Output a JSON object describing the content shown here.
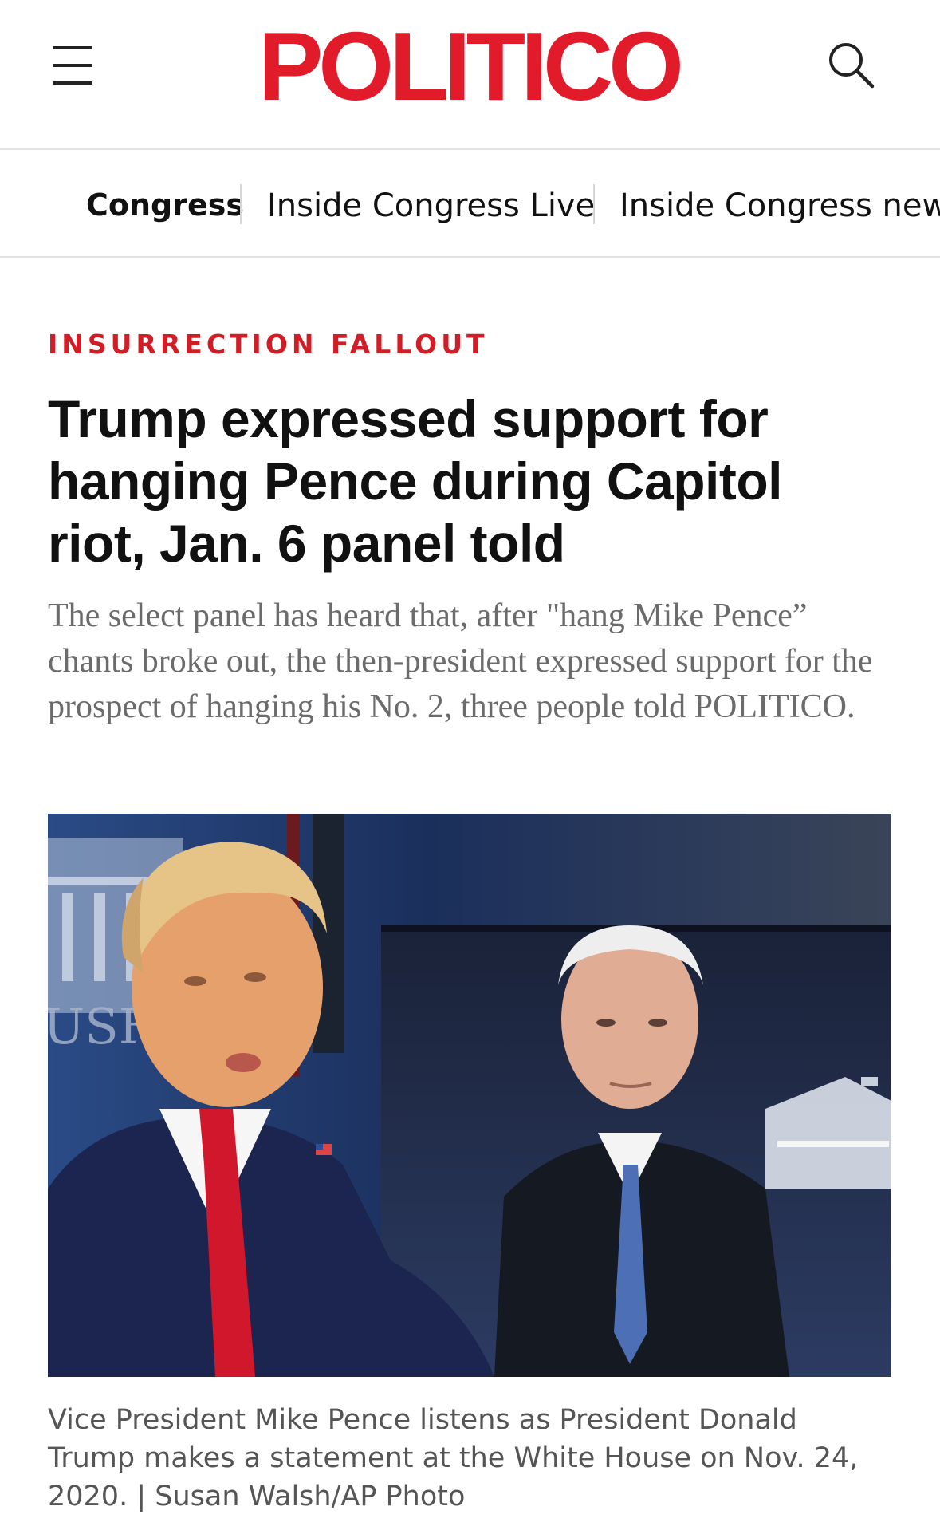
{
  "header": {
    "logo": "POLITICO",
    "menu_icon": "hamburger-menu-icon",
    "search_icon": "search-icon",
    "brand_color": "#e21b2b"
  },
  "subnav": {
    "section": "Congress",
    "items": [
      "Inside Congress Live",
      "Inside Congress newsl"
    ]
  },
  "article": {
    "kicker": "INSURRECTION FALLOUT",
    "kicker_color": "#d31d26",
    "headline": "Trump expressed support for hanging Pence during Capitol riot, Jan. 6 panel told",
    "dek": "The select panel has heard that, after \"hang Mike Pence” chants broke out, the then-president expressed support for the prospect of hanging his No. 2, three people told POLITICO.",
    "photo_alt": "Donald Trump and Mike Pence at the White House briefing room",
    "photo_backdrop_text": "USH",
    "caption": "Vice President Mike Pence listens as President Donald Trump makes a statement at the White House on Nov. 24, 2020. | Susan Walsh/AP Photo"
  }
}
